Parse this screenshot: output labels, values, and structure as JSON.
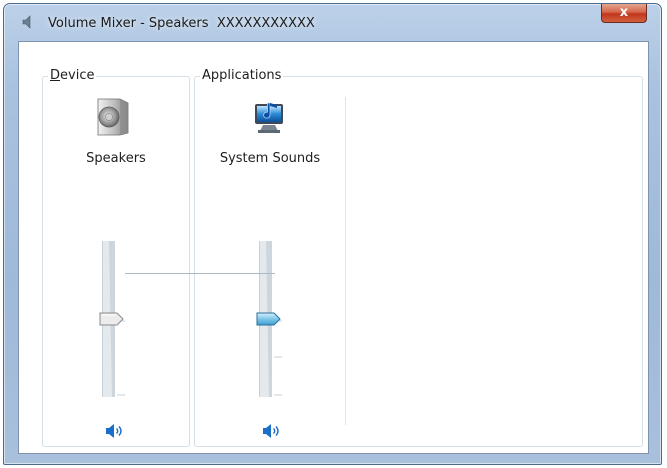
{
  "window": {
    "title": "Volume Mixer - Speakers",
    "device_name_suffix": "XXXXXXXXXXX",
    "close_label": "x"
  },
  "device_group": {
    "label_mnemonic": "D",
    "label_rest": "evice",
    "channel": {
      "name": "Speakers",
      "icon": "speaker-icon",
      "volume_level": 0.5,
      "mute_icon": "speaker-volume-icon"
    }
  },
  "applications_group": {
    "label": "Applications",
    "channels": [
      {
        "name": "System Sounds",
        "icon": "system-sounds-icon",
        "volume_level": 0.5,
        "mute_icon": "speaker-volume-icon"
      }
    ]
  },
  "colors": {
    "title_bar": "#a9c2df",
    "close_button": "#c1361c",
    "active_thumb": "#7cc6ea",
    "inactive_thumb": "#e8e8e8",
    "mute_icon": "#1a6fc9"
  }
}
